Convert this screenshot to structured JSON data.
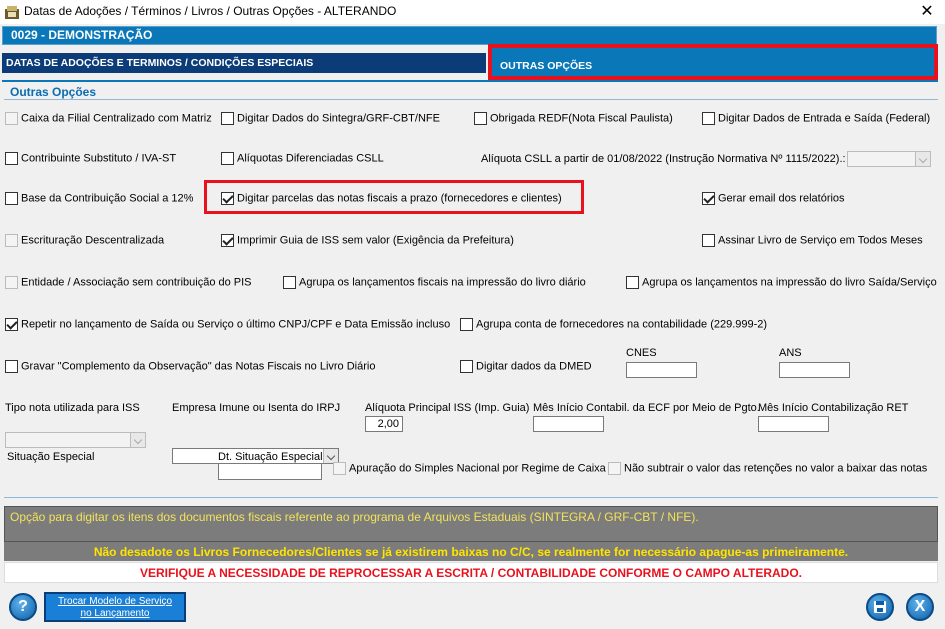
{
  "window": {
    "title": "Datas de Adoções / Términos / Livros / Outras Opções   -   ALTERANDO",
    "close_glyph": "✕"
  },
  "company": {
    "code_label": "0029   -   DEMONSTRAÇÃO"
  },
  "tabs": [
    {
      "label": "DATAS DE ADOÇÕES E TERMINOS / CONDIÇÕES ESPECIAIS",
      "active": false
    },
    {
      "label": "OUTRAS OPÇÕES",
      "active": true
    }
  ],
  "section": {
    "title": "Outras Opções"
  },
  "options": {
    "caixa_filial": {
      "label": "Caixa da Filial Centralizado com Matriz",
      "checked": false,
      "enabled": false
    },
    "digitar_sintegra": {
      "label": "Digitar Dados do Sintegra/GRF-CBT/NFE",
      "checked": false,
      "enabled": true
    },
    "obrigada_redf": {
      "label": "Obrigada REDF(Nota Fiscal Paulista)",
      "checked": false,
      "enabled": true
    },
    "digitar_entrada_saida": {
      "label": "Digitar Dados de Entrada e Saída (Federal)",
      "checked": false,
      "enabled": true
    },
    "contribuinte_substituto": {
      "label": "Contribuinte Substituto / IVA-ST",
      "checked": false,
      "enabled": true
    },
    "aliquotas_csll": {
      "label": "Alíquotas Diferenciadas CSLL",
      "checked": false,
      "enabled": true
    },
    "base_contribuicao": {
      "label": "Base da Contribuição Social a 12%",
      "checked": false,
      "enabled": true
    },
    "digitar_parcelas": {
      "label": "Digitar parcelas das notas fiscais a prazo (fornecedores e clientes)",
      "checked": true,
      "enabled": true
    },
    "gerar_email": {
      "label": "Gerar email dos relatórios",
      "checked": true,
      "enabled": true
    },
    "escrituracao_descentralizada": {
      "label": "Escrituração Descentralizada",
      "checked": false,
      "enabled": false
    },
    "imprimir_guia_iss": {
      "label": "Imprimir Guia de ISS sem valor (Exigência da Prefeitura)",
      "checked": true,
      "enabled": true
    },
    "assinar_livro": {
      "label": "Assinar Livro de Serviço em Todos Meses",
      "checked": false,
      "enabled": true
    },
    "entidade_associacao": {
      "label": "Entidade / Associação sem contribuição do PIS",
      "checked": false,
      "enabled": false
    },
    "agrupa_lancamentos_diario": {
      "label": "Agrupa os lançamentos fiscais na impressão do livro diário",
      "checked": false,
      "enabled": true
    },
    "agrupa_lancamentos_saida": {
      "label": "Agrupa os lançamentos na impressão do livro Saída/Serviço",
      "checked": false,
      "enabled": true
    },
    "repetir_lancamento": {
      "label": "Repetir no lançamento de Saída ou Serviço o último CNPJ/CPF e Data Emissão incluso",
      "checked": true,
      "enabled": true
    },
    "agrupa_conta_fornecedores": {
      "label": "Agrupa conta de fornecedores na contabilidade (229.999-2)",
      "checked": false,
      "enabled": true
    },
    "gravar_complemento": {
      "label": "Gravar \"Complemento da Observação\" das Notas Fiscais no Livro Diário",
      "checked": false,
      "enabled": true
    },
    "digitar_dmed": {
      "label": "Digitar dados da DMED",
      "checked": false,
      "enabled": true
    },
    "apuracao_simples": {
      "label": "Apuração do Simples Nacional por Regime de Caixa",
      "checked": false,
      "enabled": false
    },
    "nao_subtrair": {
      "label": "Não subtrair o valor das retenções no valor a baixar das notas",
      "checked": false,
      "enabled": false
    }
  },
  "fields": {
    "aliquota_csll_label": "Alíquota CSLL a partir de 01/08/2022 (Instrução Normativa Nº 1115/2022).:",
    "aliquota_csll_value": "",
    "cnes_label": "CNES",
    "cnes_value": "",
    "ans_label": "ANS",
    "ans_value": "",
    "tipo_nota_label": "Tipo nota utilizada para ISS",
    "tipo_nota_value": "",
    "empresa_imune_label": "Empresa Imune ou Isenta do IRPJ",
    "empresa_imune_value": "",
    "aliquota_iss_label": "Alíquota Principal ISS (Imp. Guia)",
    "aliquota_iss_value": "2,00",
    "mes_inicio_ecf_label": "Mês Início Contabil. da ECF por Meio de Pgto.",
    "mes_inicio_ecf_value": "",
    "mes_inicio_ret_label": "Mês Início Contabilização RET",
    "mes_inicio_ret_value": "",
    "situacao_especial_label": "Situação Especial",
    "situacao_especial_value": "",
    "dt_situacao_label": "Dt. Situação Especial",
    "dt_situacao_value": ""
  },
  "messages": {
    "info": "Opção para digitar os itens dos documentos fiscais referente ao programa de Arquivos Estaduais (SINTEGRA / GRF-CBT / NFE).",
    "warning_yellow": "Não desadote os Livros Fornecedores/Clientes se já existirem baixas no C/C, se realmente for necessário apague-as primeiramente.",
    "warning_red": "VERIFIQUE A NECESSIDADE DE REPROCESSAR A ESCRITA / CONTABILIDADE CONFORME O CAMPO ALTERADO."
  },
  "footer": {
    "help_glyph": "?",
    "trocar_line1": "Trocar Modelo de Serviço",
    "trocar_line2": "no Lançamento",
    "exit_glyph": "X"
  },
  "colors": {
    "accent_blue": "#0a78b8",
    "dark_blue": "#0c3c78",
    "highlight_red": "#e8121e",
    "warning_yellow": "#ffe400"
  }
}
